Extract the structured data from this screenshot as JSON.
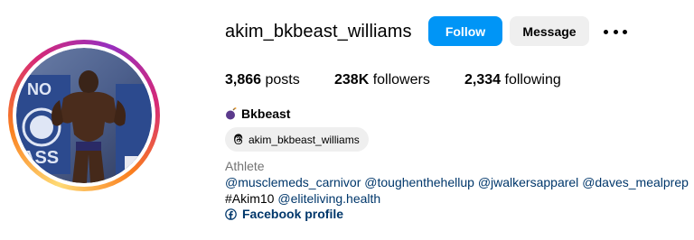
{
  "profile": {
    "username": "akim_bkbeast_williams",
    "display_name": "Bkbeast",
    "threads_handle": "akim_bkbeast_williams",
    "category": "Athlete",
    "avatar_icon": "bodybuilder-photo"
  },
  "actions": {
    "follow_label": "Follow",
    "message_label": "Message",
    "more_icon": "more-horizontal-icon"
  },
  "stats": {
    "posts_count": "3,866",
    "posts_label": "posts",
    "followers_count": "238K",
    "followers_label": "followers",
    "following_count": "2,334",
    "following_label": "following"
  },
  "bio": {
    "line1_mentions": [
      "@musclemeds_carnivor",
      "@toughenthehellup",
      "@jwalkersapparel",
      "@daves_mealprep"
    ],
    "line2_hashtag": "#Akim10",
    "line2_mention": "@eliteliving.health"
  },
  "links": {
    "facebook_label": "Facebook profile"
  },
  "colors": {
    "follow_button": "#0095f6",
    "secondary_button": "#efefef",
    "link_text": "#00376b",
    "muted_text": "#737373"
  }
}
